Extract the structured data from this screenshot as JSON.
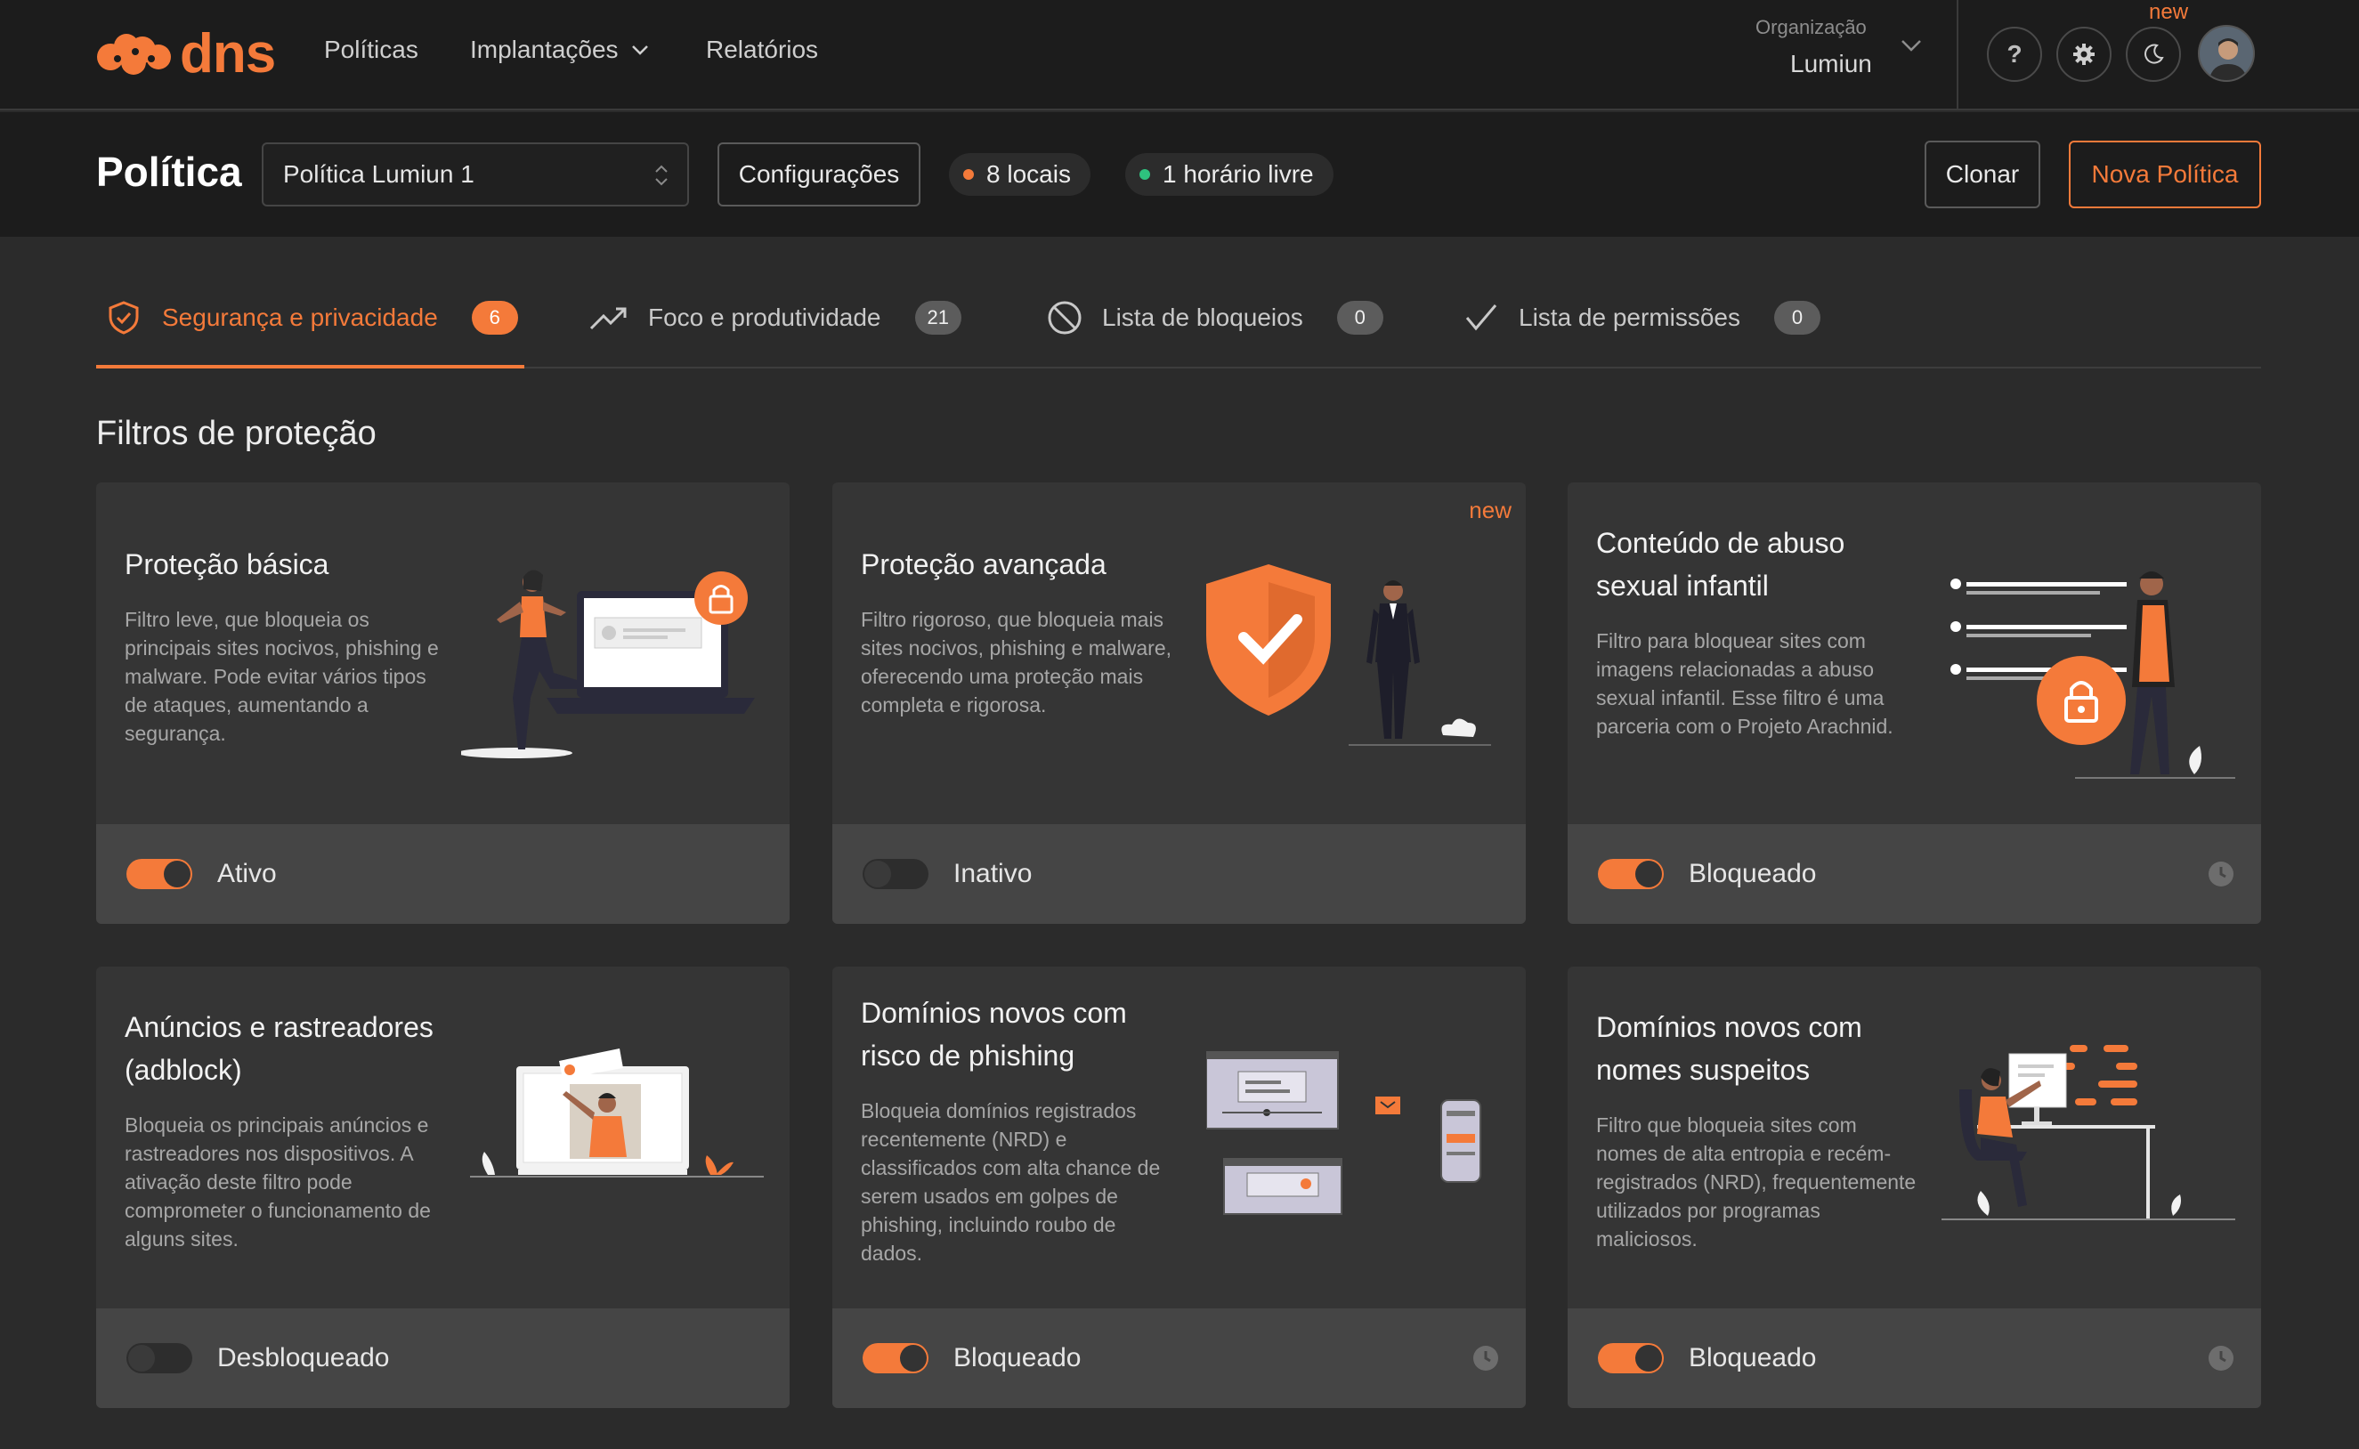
{
  "colors": {
    "accent": "#f47a3a",
    "green": "#2ec27e"
  },
  "nav": {
    "logo_text": "dns",
    "items": [
      {
        "label": "Políticas"
      },
      {
        "label": "Implantações"
      },
      {
        "label": "Relatórios"
      }
    ],
    "org_label": "Organização",
    "org_name": "Lumiun",
    "new_tag": "new",
    "help_icon": "?"
  },
  "policy": {
    "title": "Política",
    "selected": "Política Lumiun 1",
    "config_label": "Configurações",
    "locations_pill": "8 locais",
    "schedule_pill": "1 horário livre",
    "clone_label": "Clonar",
    "new_policy_label": "Nova Política"
  },
  "tabs": [
    {
      "label": "Segurança e privacidade",
      "count": "6",
      "icon": "shield-check-icon"
    },
    {
      "label": "Foco e produtividade",
      "count": "21",
      "icon": "trending-up-icon"
    },
    {
      "label": "Lista de bloqueios",
      "count": "0",
      "icon": "block-icon"
    },
    {
      "label": "Lista de permissões",
      "count": "0",
      "icon": "check-icon"
    }
  ],
  "section_title": "Filtros de proteção",
  "cards": [
    {
      "title": "Proteção básica",
      "desc": "Filtro leve, que bloqueia os principais sites nocivos, phishing e malware. Pode evitar vários tipos de ataques, aumentando a segurança.",
      "status": "Ativo",
      "on": true,
      "new": ""
    },
    {
      "title": "Proteção avançada",
      "desc": "Filtro rigoroso, que bloqueia mais sites nocivos, phishing e malware, oferecendo uma proteção mais completa e rigorosa.",
      "status": "Inativo",
      "on": false,
      "new": "new"
    },
    {
      "title": "Conteúdo de abuso sexual infantil",
      "desc": "Filtro para bloquear sites com imagens relacionadas a abuso sexual infantil. Esse filtro é uma parceria com o Projeto Arachnid.",
      "status": "Bloqueado",
      "on": true,
      "new": ""
    },
    {
      "title": "Anúncios e rastreadores (adblock)",
      "desc": "Bloqueia os principais anúncios e rastreadores nos dispositivos. A ativação deste filtro pode comprometer o funcionamento de alguns sites.",
      "status": "Desbloqueado",
      "on": false,
      "new": ""
    },
    {
      "title": "Domínios novos com risco de phishing",
      "desc": "Bloqueia domínios registrados recentemente (NRD) e classificados com alta chance de serem usados em golpes de phishing, incluindo roubo de dados.",
      "status": "Bloqueado",
      "on": true,
      "new": ""
    },
    {
      "title": "Domínios novos com nomes suspeitos",
      "desc": "Filtro que bloqueia sites com nomes de alta entropia e recém-registrados (NRD), frequentemente utilizados por programas maliciosos.",
      "status": "Bloqueado",
      "on": true,
      "new": ""
    }
  ]
}
